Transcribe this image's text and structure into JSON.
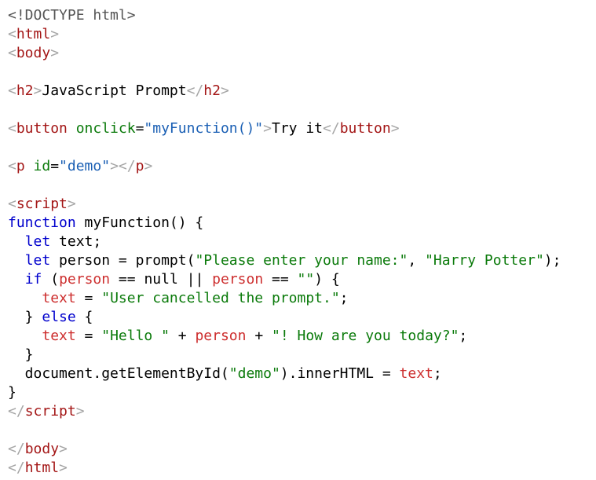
{
  "colors": {
    "bracket": "#a6a6a6",
    "tag": "#a31515",
    "attr": "#0a7a0a",
    "string": "#1a5fb4",
    "keyword": "#0000cd",
    "variable": "#cd2e2e",
    "js_string": "#0a7a0a",
    "plain": "#000000",
    "doctype": "#555555"
  },
  "code": {
    "lines": [
      [
        {
          "t": "<!DOCTYPE html>",
          "c": "doctype"
        }
      ],
      [
        {
          "t": "<",
          "c": "bracket"
        },
        {
          "t": "html",
          "c": "tag"
        },
        {
          "t": ">",
          "c": "bracket"
        }
      ],
      [
        {
          "t": "<",
          "c": "bracket"
        },
        {
          "t": "body",
          "c": "tag"
        },
        {
          "t": ">",
          "c": "bracket"
        }
      ],
      [],
      [
        {
          "t": "<",
          "c": "bracket"
        },
        {
          "t": "h2",
          "c": "tag"
        },
        {
          "t": ">",
          "c": "bracket"
        },
        {
          "t": "JavaScript Prompt",
          "c": "plain"
        },
        {
          "t": "</",
          "c": "bracket"
        },
        {
          "t": "h2",
          "c": "tag"
        },
        {
          "t": ">",
          "c": "bracket"
        }
      ],
      [],
      [
        {
          "t": "<",
          "c": "bracket"
        },
        {
          "t": "button",
          "c": "tag"
        },
        {
          "t": " onclick",
          "c": "attr"
        },
        {
          "t": "=",
          "c": "plain"
        },
        {
          "t": "\"myFunction()\"",
          "c": "string"
        },
        {
          "t": ">",
          "c": "bracket"
        },
        {
          "t": "Try it",
          "c": "plain"
        },
        {
          "t": "</",
          "c": "bracket"
        },
        {
          "t": "button",
          "c": "tag"
        },
        {
          "t": ">",
          "c": "bracket"
        }
      ],
      [],
      [
        {
          "t": "<",
          "c": "bracket"
        },
        {
          "t": "p",
          "c": "tag"
        },
        {
          "t": " id",
          "c": "attr"
        },
        {
          "t": "=",
          "c": "plain"
        },
        {
          "t": "\"demo\"",
          "c": "string"
        },
        {
          "t": "></",
          "c": "bracket"
        },
        {
          "t": "p",
          "c": "tag"
        },
        {
          "t": ">",
          "c": "bracket"
        }
      ],
      [],
      [
        {
          "t": "<",
          "c": "bracket"
        },
        {
          "t": "script",
          "c": "tag"
        },
        {
          "t": ">",
          "c": "bracket"
        }
      ],
      [
        {
          "t": "function",
          "c": "keyword"
        },
        {
          "t": " myFunction() {",
          "c": "plain"
        }
      ],
      [
        {
          "t": "  ",
          "c": "plain"
        },
        {
          "t": "let",
          "c": "keyword"
        },
        {
          "t": " text;",
          "c": "plain"
        }
      ],
      [
        {
          "t": "  ",
          "c": "plain"
        },
        {
          "t": "let",
          "c": "keyword"
        },
        {
          "t": " person = prompt(",
          "c": "plain"
        },
        {
          "t": "\"Please enter your name:\"",
          "c": "js_string"
        },
        {
          "t": ", ",
          "c": "plain"
        },
        {
          "t": "\"Harry Potter\"",
          "c": "js_string"
        },
        {
          "t": ");",
          "c": "plain"
        }
      ],
      [
        {
          "t": "  ",
          "c": "plain"
        },
        {
          "t": "if",
          "c": "keyword"
        },
        {
          "t": " (",
          "c": "plain"
        },
        {
          "t": "person",
          "c": "variable"
        },
        {
          "t": " == null || ",
          "c": "plain"
        },
        {
          "t": "person",
          "c": "variable"
        },
        {
          "t": " == ",
          "c": "plain"
        },
        {
          "t": "\"\"",
          "c": "js_string"
        },
        {
          "t": ") {",
          "c": "plain"
        }
      ],
      [
        {
          "t": "    ",
          "c": "plain"
        },
        {
          "t": "text",
          "c": "variable"
        },
        {
          "t": " = ",
          "c": "plain"
        },
        {
          "t": "\"User cancelled the prompt.\"",
          "c": "js_string"
        },
        {
          "t": ";",
          "c": "plain"
        }
      ],
      [
        {
          "t": "  } ",
          "c": "plain"
        },
        {
          "t": "else",
          "c": "keyword"
        },
        {
          "t": " {",
          "c": "plain"
        }
      ],
      [
        {
          "t": "    ",
          "c": "plain"
        },
        {
          "t": "text",
          "c": "variable"
        },
        {
          "t": " = ",
          "c": "plain"
        },
        {
          "t": "\"Hello \"",
          "c": "js_string"
        },
        {
          "t": " + ",
          "c": "plain"
        },
        {
          "t": "person",
          "c": "variable"
        },
        {
          "t": " + ",
          "c": "plain"
        },
        {
          "t": "\"! How are you today?\"",
          "c": "js_string"
        },
        {
          "t": ";",
          "c": "plain"
        }
      ],
      [
        {
          "t": "  }",
          "c": "plain"
        }
      ],
      [
        {
          "t": "  document.getElementById(",
          "c": "plain"
        },
        {
          "t": "\"demo\"",
          "c": "js_string"
        },
        {
          "t": ").innerHTML = ",
          "c": "plain"
        },
        {
          "t": "text",
          "c": "variable"
        },
        {
          "t": ";",
          "c": "plain"
        }
      ],
      [
        {
          "t": "}",
          "c": "plain"
        }
      ],
      [
        {
          "t": "</",
          "c": "bracket"
        },
        {
          "t": "script",
          "c": "tag"
        },
        {
          "t": ">",
          "c": "bracket"
        }
      ],
      [],
      [
        {
          "t": "</",
          "c": "bracket"
        },
        {
          "t": "body",
          "c": "tag"
        },
        {
          "t": ">",
          "c": "bracket"
        }
      ],
      [
        {
          "t": "</",
          "c": "bracket"
        },
        {
          "t": "html",
          "c": "tag"
        },
        {
          "t": ">",
          "c": "bracket"
        }
      ]
    ]
  }
}
